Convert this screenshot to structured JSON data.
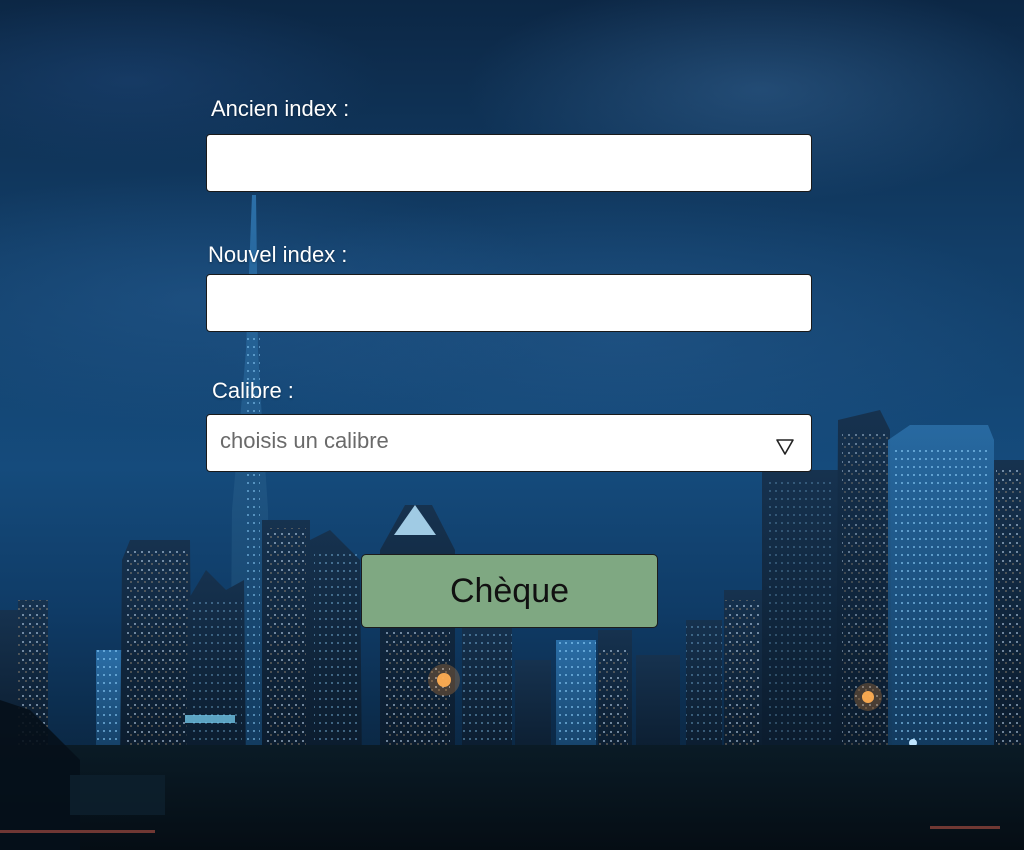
{
  "form": {
    "ancien_index": {
      "label": "Ancien index :",
      "value": ""
    },
    "nouvel_index": {
      "label": "Nouvel index :",
      "value": ""
    },
    "calibre": {
      "label": "Calibre :",
      "selected": "choisis un calibre"
    },
    "submit_label": "Chèque"
  },
  "colors": {
    "button_background": "#7fa882",
    "label_text": "#ffffff",
    "field_background": "#ffffff"
  },
  "icons": {
    "select_arrow": "triangle-down-outline-icon"
  }
}
